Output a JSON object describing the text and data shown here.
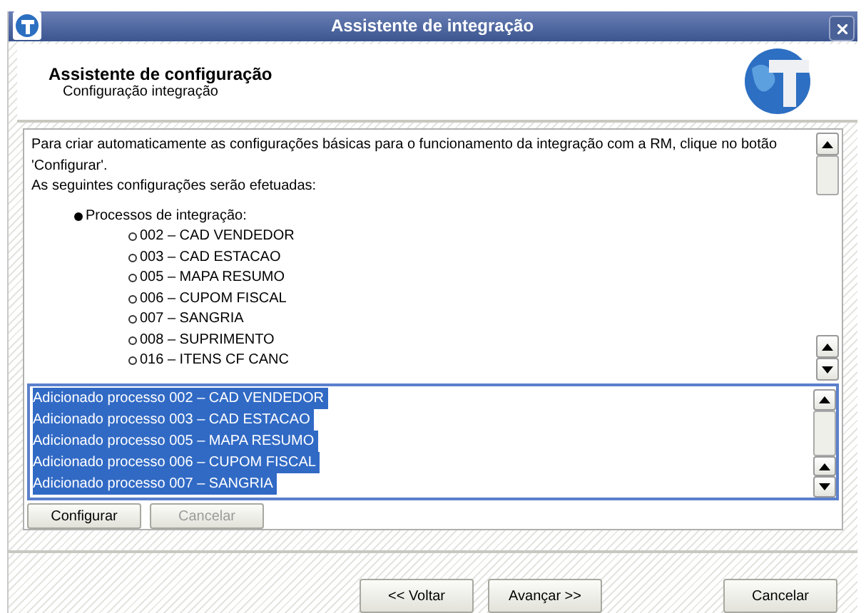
{
  "window": {
    "title": "Assistente de integração"
  },
  "header": {
    "title": "Assistente de configuração",
    "subtitle": "Configuração integração"
  },
  "info": {
    "paragraphs": [
      "Para criar automaticamente as configurações básicas para o funcionamento da integração com a RM, clique no botão 'Configurar'.",
      "As seguintes configurações serão efetuadas:"
    ],
    "bullet": "Processos de integração:",
    "items": [
      "002 – CAD VENDEDOR",
      "003 – CAD ESTACAO",
      "005 – MAPA RESUMO",
      "006 – CUPOM FISCAL",
      "007 – SANGRIA",
      "008 – SUPRIMENTO",
      "016 – ITENS CF CANC"
    ]
  },
  "log": [
    {
      "text": "Adicionado processo 002 – CAD VENDEDOR",
      "selected": true
    },
    {
      "text": "Adicionado processo 003 – CAD ESTACAO",
      "selected": true
    },
    {
      "text": "Adicionado processo 005 – MAPA RESUMO",
      "selected": true
    },
    {
      "text": "Adicionado processo 006 – CUPOM FISCAL",
      "selected": true
    },
    {
      "text": "Adicionado processo 007 – SANGRIA",
      "selected": true
    }
  ],
  "panel_buttons": [
    {
      "label": "Configurar",
      "disabled": false
    },
    {
      "label": "Cancelar",
      "disabled": true
    }
  ],
  "nav_buttons": [
    {
      "label": "<< Voltar",
      "disabled": false
    },
    {
      "label": "Avançar >>",
      "disabled": false
    },
    {
      "label": "Cancelar",
      "disabled": false
    }
  ]
}
